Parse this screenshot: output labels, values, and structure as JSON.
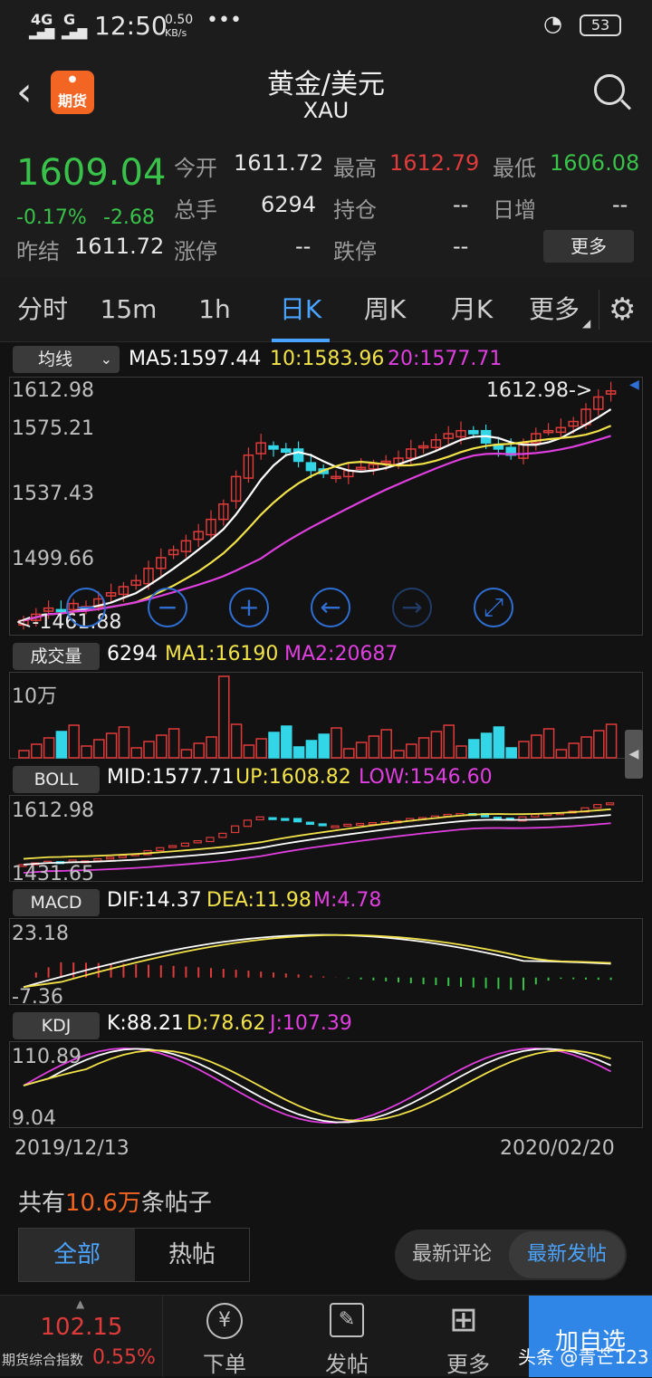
{
  "status_bar": {
    "network": "4G",
    "network2": "G",
    "time": "12:50",
    "speed": "0.50",
    "speed_unit": "KB/s",
    "dots": "•••",
    "battery": "53"
  },
  "header": {
    "title": "黄金/美元",
    "subtitle": "XAU",
    "logo_text": "期货"
  },
  "quote": {
    "price": "1609.04",
    "change_pct": "-0.17%",
    "change": "-2.68",
    "prev_close_label": "昨结",
    "prev_close": "1611.72",
    "open_label": "今开",
    "open": "1611.72",
    "high_label": "最高",
    "high": "1612.79",
    "low_label": "最低",
    "low": "1606.08",
    "volume_label": "总手",
    "volume": "6294",
    "position_label": "持仓",
    "position": "--",
    "daily_inc_label": "日增",
    "daily_inc": "--",
    "limit_up_label": "涨停",
    "limit_up": "--",
    "limit_down_label": "跌停",
    "limit_down": "--",
    "more_button": "更多"
  },
  "tabs": [
    {
      "label": "分时"
    },
    {
      "label": "15m"
    },
    {
      "label": "1h"
    },
    {
      "label": "日K"
    },
    {
      "label": "周K"
    },
    {
      "label": "月K"
    },
    {
      "label": "更多"
    }
  ],
  "ma_panel": {
    "selector": "均线",
    "ma5": "MA5:1597.44",
    "ma10": "10:1583.96",
    "ma20": "20:1577.71",
    "y_labels": [
      "1612.98",
      "1575.21",
      "1537.43",
      "1499.66"
    ],
    "low_marker": "<-1461.88",
    "high_marker": "1612.98->"
  },
  "volume_panel": {
    "label": "成交量",
    "value": "6294",
    "ma1": "MA1:16190",
    "ma2": "MA2:20687",
    "y_label": "10万"
  },
  "boll_panel": {
    "label": "BOLL",
    "mid": "MID:1577.71",
    "up": "UP:1608.82",
    "low": "LOW:1546.60",
    "y_top": "1612.98",
    "y_bottom": "1431.65"
  },
  "macd_panel": {
    "label": "MACD",
    "dif": "DIF:14.37",
    "dea": "DEA:11.98",
    "m": "M:4.78",
    "y_top": "23.18",
    "y_bottom": "-7.36"
  },
  "kdj_panel": {
    "label": "KDJ",
    "k": "K:88.21",
    "d": "D:78.62",
    "j": "J:107.39",
    "y_top": "110.89",
    "y_bottom": "9.04"
  },
  "dates": {
    "start": "2019/12/13",
    "end": "2020/02/20"
  },
  "posts": {
    "prefix": "共有",
    "count": "10.6万",
    "suffix": "条帖子",
    "tab_all": "全部",
    "tab_hot": "热帖",
    "sort_comment": "最新评论",
    "sort_post": "最新发帖"
  },
  "bottom_bar": {
    "index_value": "102.15",
    "index_name": "期货综合指数",
    "index_pct": "0.55%",
    "order": "下单",
    "post": "发帖",
    "more": "更多",
    "add_watch": "加自选",
    "watermark": "头条 @青芒123"
  },
  "colors": {
    "up": "#e03b3b",
    "down": "#33d6e6",
    "gain": "#39c24a",
    "accent": "#4aa3ff",
    "ma5": "#ffffff",
    "ma10": "#f2e24a",
    "ma20": "#e03fe0"
  }
}
